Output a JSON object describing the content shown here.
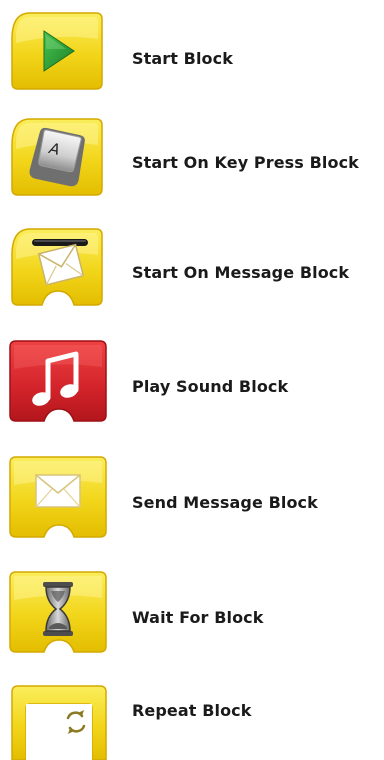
{
  "blocks": [
    {
      "name": "start",
      "label": "Start Block",
      "icon": "play-triangle-icon"
    },
    {
      "name": "start-on-key-press",
      "label": "Start On Key Press Block",
      "icon": "keyboard-key-icon",
      "key_glyph": "A"
    },
    {
      "name": "start-on-message",
      "label": "Start On Message Block",
      "icon": "message-slot-icon"
    },
    {
      "name": "play-sound",
      "label": "Play Sound Block",
      "icon": "music-note-icon"
    },
    {
      "name": "send-message",
      "label": "Send Message Block",
      "icon": "envelope-icon"
    },
    {
      "name": "wait-for",
      "label": "Wait For Block",
      "icon": "hourglass-icon"
    },
    {
      "name": "repeat",
      "label": "Repeat Block",
      "icon": "repeat-arrows-icon"
    }
  ],
  "colors": {
    "yellow_light": "#f9e94a",
    "yellow": "#efcd10",
    "yellow_dark": "#d9b000",
    "red_light": "#ea3a3a",
    "red": "#cf1f26",
    "red_dark": "#a8151b",
    "green": "#2a9a35",
    "label_text": "#1a1a1a"
  }
}
